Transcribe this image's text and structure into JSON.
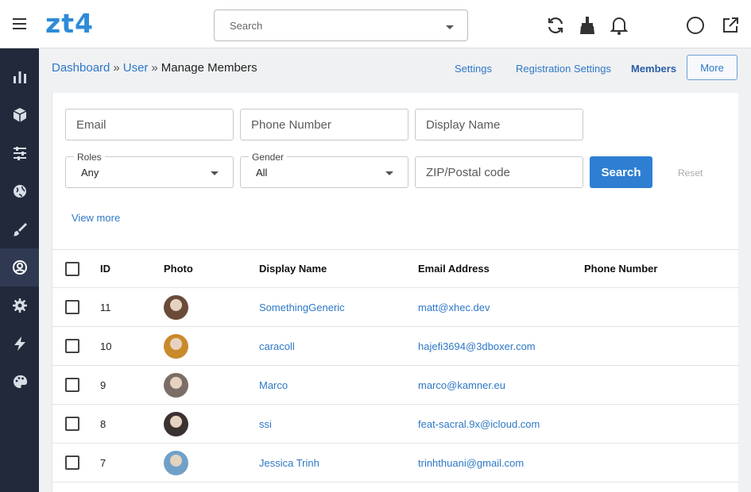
{
  "app": {
    "logo": "zt4"
  },
  "topbar": {
    "search_placeholder": "Search",
    "icons": [
      "menu-icon",
      "refresh-icon",
      "broom-icon",
      "bell-icon",
      "help-icon",
      "external-link-icon"
    ]
  },
  "sidebar": {
    "items": [
      {
        "name": "dashboard",
        "icon": "bar-chart-icon"
      },
      {
        "name": "extend",
        "icon": "cube-icon"
      },
      {
        "name": "manage",
        "icon": "sliders-icon"
      },
      {
        "name": "content",
        "icon": "globe-icon"
      },
      {
        "name": "appearance",
        "icon": "brush-icon"
      },
      {
        "name": "users",
        "icon": "user-circle-icon",
        "active": true
      },
      {
        "name": "settings",
        "icon": "gear-icon"
      },
      {
        "name": "performance",
        "icon": "bolt-icon"
      },
      {
        "name": "theme",
        "icon": "palette-icon"
      }
    ]
  },
  "breadcrumb": {
    "items": [
      "Dashboard",
      "User"
    ],
    "current": "Manage Members",
    "separator": "»"
  },
  "subnav": {
    "settings": "Settings",
    "registration": "Registration Settings",
    "members": "Members",
    "more": "More"
  },
  "filters": {
    "email_placeholder": "Email",
    "phone_placeholder": "Phone Number",
    "display_name_placeholder": "Display Name",
    "roles_label": "Roles",
    "roles_value": "Any",
    "gender_label": "Gender",
    "gender_value": "All",
    "zip_placeholder": "ZIP/Postal code",
    "search_button": "Search",
    "reset_button": "Reset",
    "view_more": "View more"
  },
  "table": {
    "headers": {
      "id": "ID",
      "photo": "Photo",
      "display_name": "Display Name",
      "email": "Email Address",
      "phone": "Phone Number"
    },
    "rows": [
      {
        "id": "11",
        "display_name": "SomethingGeneric",
        "email": "matt@xhec.dev",
        "phone": "",
        "avatar_color": "#6b4a3a"
      },
      {
        "id": "10",
        "display_name": "caracoll",
        "email": "hajefi3694@3dboxer.com",
        "phone": "",
        "avatar_color": "#c98a2c"
      },
      {
        "id": "9",
        "display_name": "Marco",
        "email": "marco@kamner.eu",
        "phone": "",
        "avatar_color": "#7a6e66"
      },
      {
        "id": "8",
        "display_name": "ssi",
        "email": "feat-sacral.9x@icloud.com",
        "phone": "",
        "avatar_color": "#3a3230"
      },
      {
        "id": "7",
        "display_name": "Jessica Trinh",
        "email": "trinhthuani@gmail.com",
        "phone": "",
        "avatar_color": "#6fa0c8"
      }
    ]
  },
  "colors": {
    "accent": "#2e7fd3",
    "sidebar_bg": "#22293a",
    "link": "#2e78c6"
  }
}
